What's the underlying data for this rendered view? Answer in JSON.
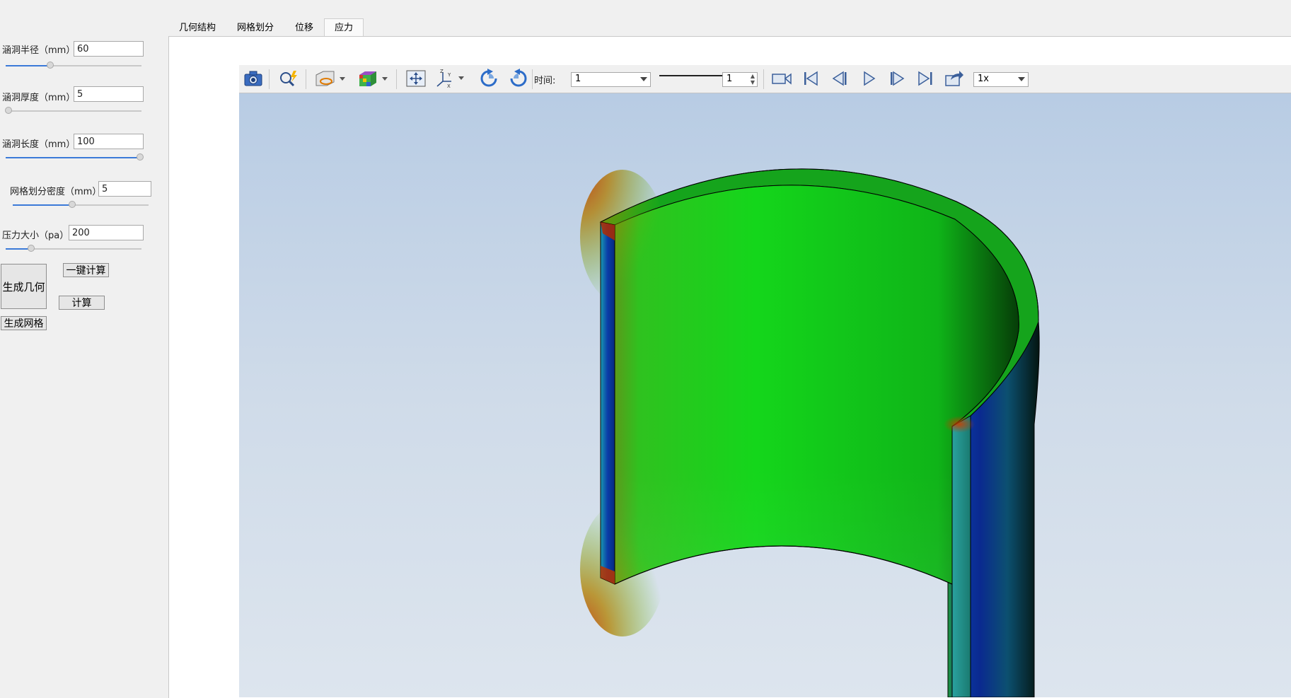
{
  "sidebar": {
    "radius": {
      "label": "涵洞半径（mm）",
      "value": "60",
      "slider": 0.33
    },
    "thickness": {
      "label": "涵洞厚度（mm）",
      "value": "5",
      "slider": 0.02
    },
    "length": {
      "label": "涵洞长度（mm）",
      "value": "100",
      "slider": 0.99
    },
    "mesh_density": {
      "label": "网格划分密度（mm）",
      "value": "5",
      "slider": 0.44
    },
    "pressure": {
      "label": "压力大小（pa）",
      "value": "200",
      "slider": 0.19
    },
    "buttons": {
      "generate_geometry": "生成几何",
      "one_click_compute": "一键计算",
      "compute": "计算",
      "generate_mesh": "生成网格"
    }
  },
  "tabs": [
    {
      "label": "几何结构",
      "active": false
    },
    {
      "label": "网格划分",
      "active": false
    },
    {
      "label": "位移",
      "active": false
    },
    {
      "label": "应力",
      "active": true
    }
  ],
  "toolbar": {
    "time_label": "时间:",
    "time_value": "1",
    "step_value": "1",
    "speed_value": "1x"
  },
  "icons": [
    "camera-icon",
    "zoom-icon",
    "clip-plane-icon",
    "color-cube-icon",
    "fit-view-icon",
    "axes-icon",
    "rotate-cw-icon",
    "rotate-ccw-icon",
    "record-video-icon",
    "first-frame-icon",
    "prev-frame-icon",
    "play-icon",
    "next-frame-icon",
    "last-frame-icon",
    "export-icon"
  ],
  "colors": {
    "accent": "#3b7ad8",
    "stress_high": "#c43000",
    "stress_mid": "#19c81e",
    "stress_low": "#0020a0"
  }
}
